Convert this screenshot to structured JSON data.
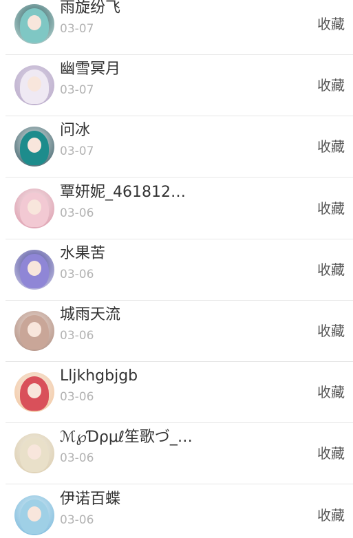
{
  "items": [
    {
      "name": "雨旋纷飞",
      "date": "03-07",
      "action": "收藏",
      "colors": [
        "#2a5a5e",
        "#7fc7c4",
        "#c9e6e2"
      ]
    },
    {
      "name": "幽雪冥月",
      "date": "03-07",
      "action": "收藏",
      "colors": [
        "#d9d2e4",
        "#efe9f3",
        "#b9a9c9"
      ]
    },
    {
      "name": "问冰",
      "date": "03-07",
      "action": "收藏",
      "colors": [
        "#e9f2f0",
        "#1d8c8c",
        "#2a4f5a"
      ]
    },
    {
      "name": "覃妍妮_461812…",
      "date": "03-06",
      "action": "收藏",
      "colors": [
        "#f6f2f2",
        "#f2c9d3",
        "#d98ea2"
      ]
    },
    {
      "name": "水果苦",
      "date": "03-06",
      "action": "收藏",
      "colors": [
        "#3f3f8f",
        "#8f86d6",
        "#d9d6f2"
      ]
    },
    {
      "name": "城雨天流",
      "date": "03-06",
      "action": "收藏",
      "colors": [
        "#f2e3dc",
        "#c9a698",
        "#a88476"
      ]
    },
    {
      "name": "Lljkhgbjgb",
      "date": "03-06",
      "action": "收藏",
      "colors": [
        "#f6ece6",
        "#d9505a",
        "#f2c49a"
      ]
    },
    {
      "name": "ℳ℘Ɗρμℓ笙歌づ_…",
      "date": "03-06",
      "action": "收藏",
      "colors": [
        "#f2efe6",
        "#e9e0c9",
        "#d9c9a8"
      ]
    },
    {
      "name": "伊诺百蝶",
      "date": "03-06",
      "action": "收藏",
      "colors": [
        "#dff0f6",
        "#9fd0e6",
        "#6fb3d9"
      ]
    }
  ]
}
